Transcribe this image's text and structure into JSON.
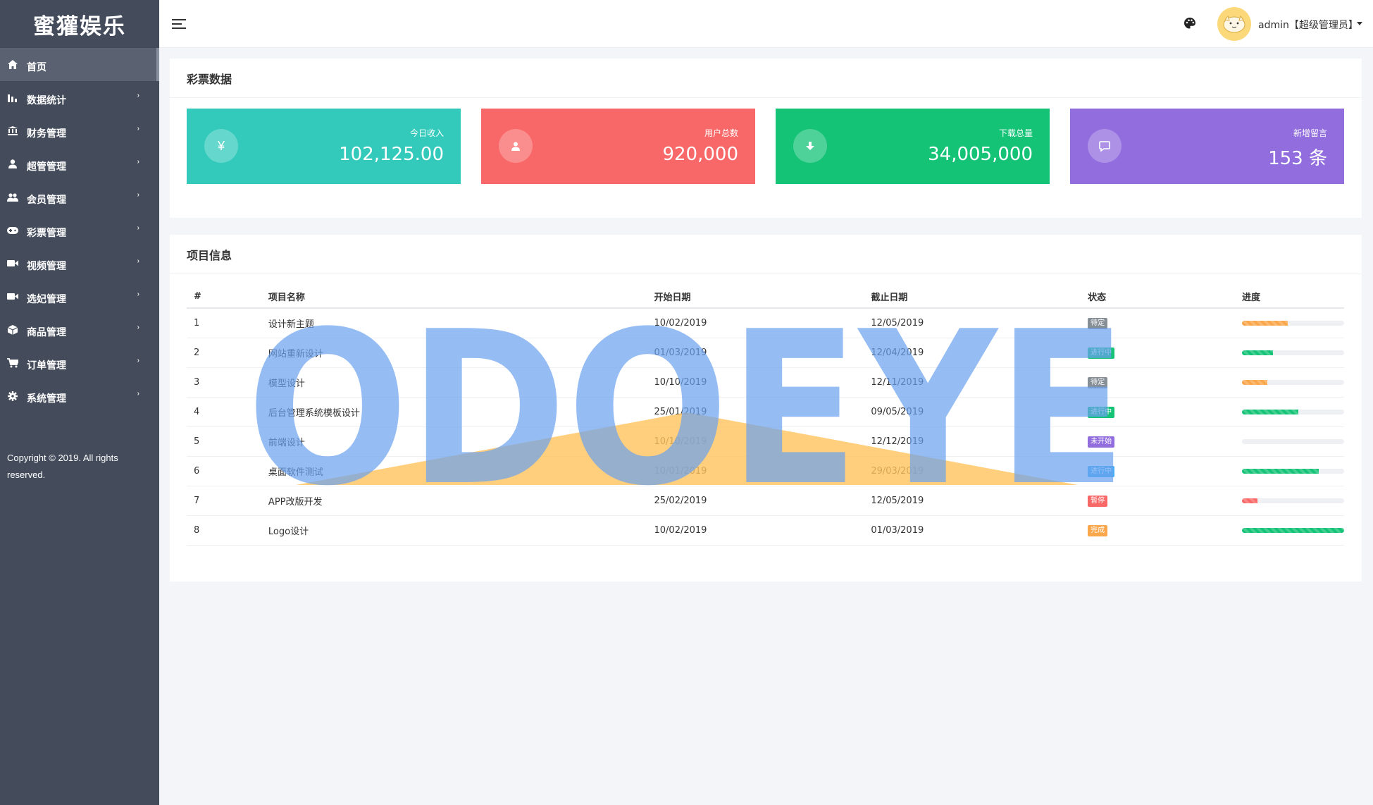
{
  "brand": "蜜獾娱乐",
  "sidebar": {
    "items": [
      {
        "label": "首页",
        "icon": "home-icon",
        "has_arrow": false,
        "active": true
      },
      {
        "label": "数据统计",
        "icon": "bar-chart-icon",
        "has_arrow": true
      },
      {
        "label": "财务管理",
        "icon": "bank-icon",
        "has_arrow": true
      },
      {
        "label": "超管管理",
        "icon": "user-icon",
        "has_arrow": true
      },
      {
        "label": "会员管理",
        "icon": "users-icon",
        "has_arrow": true
      },
      {
        "label": "彩票管理",
        "icon": "gamepad-icon",
        "has_arrow": true
      },
      {
        "label": "视频管理",
        "icon": "video-icon",
        "has_arrow": true
      },
      {
        "label": "选妃管理",
        "icon": "camera-icon",
        "has_arrow": true
      },
      {
        "label": "商品管理",
        "icon": "box-icon",
        "has_arrow": true
      },
      {
        "label": "订单管理",
        "icon": "cart-icon",
        "has_arrow": true
      },
      {
        "label": "系统管理",
        "icon": "gear-icon",
        "has_arrow": true
      }
    ],
    "arrow_glyph": "›",
    "copyright": "Copyright © 2019. All rights reserved."
  },
  "header": {
    "user": "admin【超级管理员】"
  },
  "stats_panel": {
    "title": "彩票数据",
    "cards": [
      {
        "label": "今日收入",
        "value": "102,125.00",
        "icon": "yen-icon",
        "color": "#33cabb"
      },
      {
        "label": "用户总数",
        "value": "920,000",
        "icon": "user-icon",
        "color": "#f96868"
      },
      {
        "label": "下载总量",
        "value": "34,005,000",
        "icon": "download-icon",
        "color": "#15c377"
      },
      {
        "label": "新增留言",
        "value": "153 条",
        "icon": "comment-icon",
        "color": "#926dde"
      }
    ]
  },
  "project_panel": {
    "title": "项目信息",
    "columns": [
      "#",
      "项目名称",
      "开始日期",
      "截止日期",
      "状态",
      "进度"
    ],
    "rows": [
      {
        "id": "1",
        "name": "设计新主题",
        "start": "10/02/2019",
        "end": "12/05/2019",
        "status": "待定",
        "status_color": "#868e96",
        "progress": 0.45,
        "bar_color": "#faa64b"
      },
      {
        "id": "2",
        "name": "网站重新设计",
        "start": "01/03/2019",
        "end": "12/04/2019",
        "status": "进行中",
        "status_color": "#15c377",
        "progress": 0.3,
        "bar_color": "#15c377"
      },
      {
        "id": "3",
        "name": "模型设计",
        "start": "10/10/2019",
        "end": "12/11/2019",
        "status": "待定",
        "status_color": "#868e96",
        "progress": 0.25,
        "bar_color": "#faa64b"
      },
      {
        "id": "4",
        "name": "后台管理系统模板设计",
        "start": "25/01/2019",
        "end": "09/05/2019",
        "status": "进行中",
        "status_color": "#15c377",
        "progress": 0.55,
        "bar_color": "#15c377"
      },
      {
        "id": "5",
        "name": "前端设计",
        "start": "10/10/2019",
        "end": "12/12/2019",
        "status": "未开始",
        "status_color": "#926dde",
        "progress": 0.0,
        "bar_color": "#15c377"
      },
      {
        "id": "6",
        "name": "桌面软件测试",
        "start": "10/01/2019",
        "end": "29/03/2019",
        "status": "进行中",
        "status_color": "#48b0f7",
        "progress": 0.75,
        "bar_color": "#15c377"
      },
      {
        "id": "7",
        "name": "APP改版开发",
        "start": "25/02/2019",
        "end": "12/05/2019",
        "status": "暂停",
        "status_color": "#f96868",
        "progress": 0.15,
        "bar_color": "#f96868"
      },
      {
        "id": "8",
        "name": "Logo设计",
        "start": "10/02/2019",
        "end": "01/03/2019",
        "status": "完成",
        "status_color": "#faa64b",
        "progress": 1.0,
        "bar_color": "#15c377"
      }
    ]
  },
  "watermark": "ODOEYE"
}
